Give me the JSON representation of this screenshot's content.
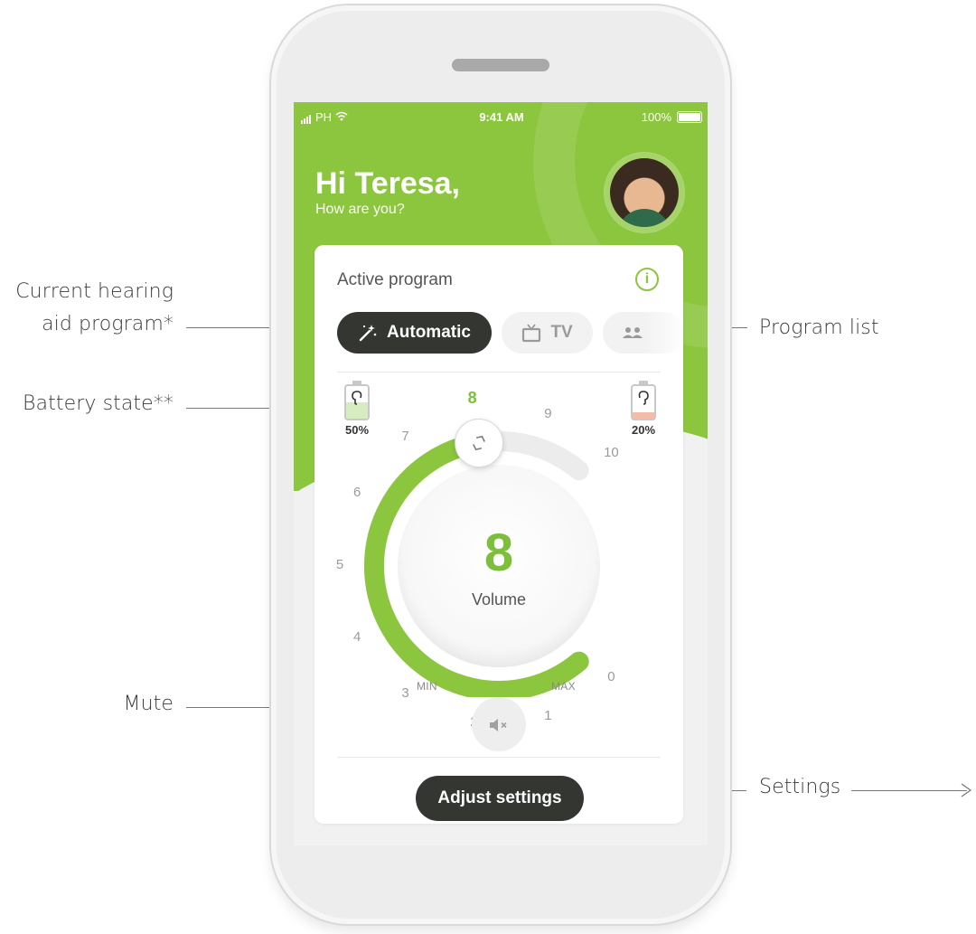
{
  "callouts": {
    "program_line1": "Current hearing",
    "program_line2": "aid program*",
    "battery": "Battery state**",
    "mute": "Mute",
    "program_list": "Program list",
    "settings": "Settings"
  },
  "status_bar": {
    "carrier": "PH",
    "time": "9:41 AM",
    "battery": "100%"
  },
  "header": {
    "greeting": "Hi Teresa,",
    "subtitle": "How are you?"
  },
  "card": {
    "title": "Active program",
    "info_icon": "i",
    "programs": [
      {
        "label": "Automatic",
        "icon": "magic-wand-icon",
        "active": true
      },
      {
        "label": "TV",
        "icon": "tv-icon",
        "active": false
      },
      {
        "label": "",
        "icon": "people-icon",
        "active": false
      }
    ]
  },
  "batteries": {
    "left": {
      "percent_label": "50%",
      "level": 0.5,
      "color": "#d7ecc0",
      "icon": "left-ear-icon"
    },
    "right": {
      "percent_label": "20%",
      "level": 0.2,
      "color": "#f2bca6",
      "icon": "right-ear-icon"
    }
  },
  "volume": {
    "value": "8",
    "label": "Volume",
    "level": 8,
    "min": 0,
    "max": 10,
    "scale": [
      "0",
      "1",
      "2",
      "3",
      "4",
      "5",
      "6",
      "7",
      "8",
      "9",
      "10"
    ],
    "min_label": "MIN",
    "max_label": "MAX",
    "accent": "#8cc63e"
  },
  "mute": {
    "icon": "speaker-mute-icon"
  },
  "actions": {
    "adjust_label": "Adjust settings"
  },
  "colors": {
    "brand_green": "#8cc63e",
    "dark_button": "#333631"
  }
}
